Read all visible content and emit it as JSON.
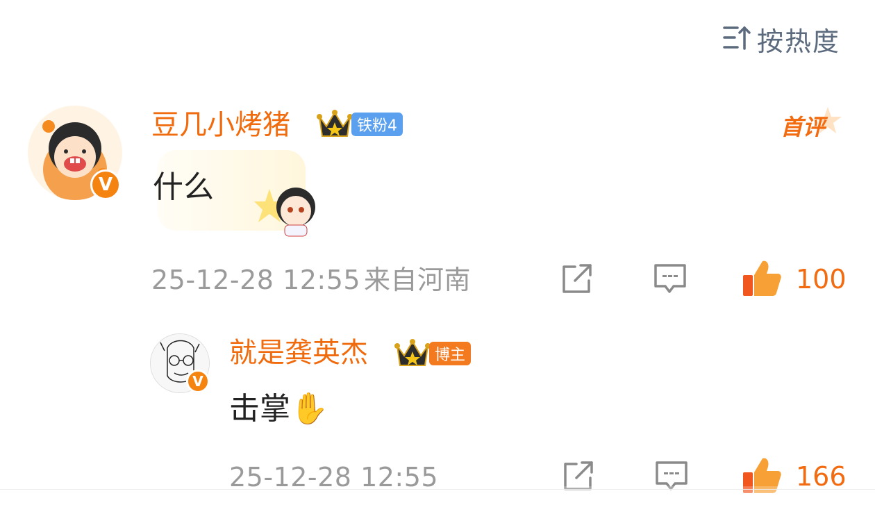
{
  "sort": {
    "label": "按热度",
    "icon": "sort-arrow-icon"
  },
  "comments": [
    {
      "username": "豆几小烤猪",
      "fan_badge": "铁粉4",
      "crown_level": "I",
      "first_comment_tag": "首评",
      "text": "什么",
      "timestamp": "25-12-28 12:55",
      "location": "来自河南",
      "likes": "100",
      "verified_badge": "V"
    },
    {
      "username": "就是龚英杰",
      "fan_badge": "博主",
      "crown_level": "II",
      "text": "击掌",
      "emoji": "✋",
      "timestamp": "25-12-28 12:55",
      "likes": "166",
      "verified_badge": "V"
    }
  ],
  "colors": {
    "username": "#f06b0e",
    "meta": "#9a9a9a",
    "like": "#f26b10",
    "fan_badge_blue": "#5aa0ee",
    "blogger_badge_orange": "#f47a1f",
    "sort_text": "#5c6a7e"
  }
}
